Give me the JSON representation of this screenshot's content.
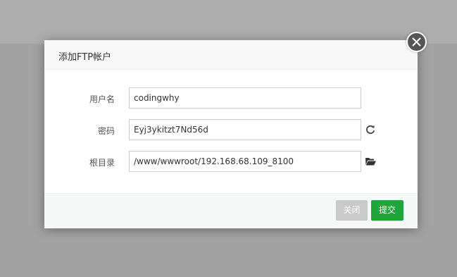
{
  "dialog": {
    "title": "添加FTP帐户"
  },
  "form": {
    "username": {
      "label": "用户名",
      "value": "codingwhy"
    },
    "password": {
      "label": "密码",
      "value": "Eyj3ykitzt7Nd56d",
      "refresh_icon": "refresh-icon"
    },
    "root_dir": {
      "label": "根目录",
      "value": "/www/wwwroot/192.168.68.109_8100",
      "folder_icon": "folder-open-icon"
    }
  },
  "footer": {
    "close_label": "关闭",
    "submit_label": "提交"
  },
  "colors": {
    "primary": "#20a53a",
    "disabled": "#c9c9c9",
    "overlay": "#a2a2a2"
  }
}
